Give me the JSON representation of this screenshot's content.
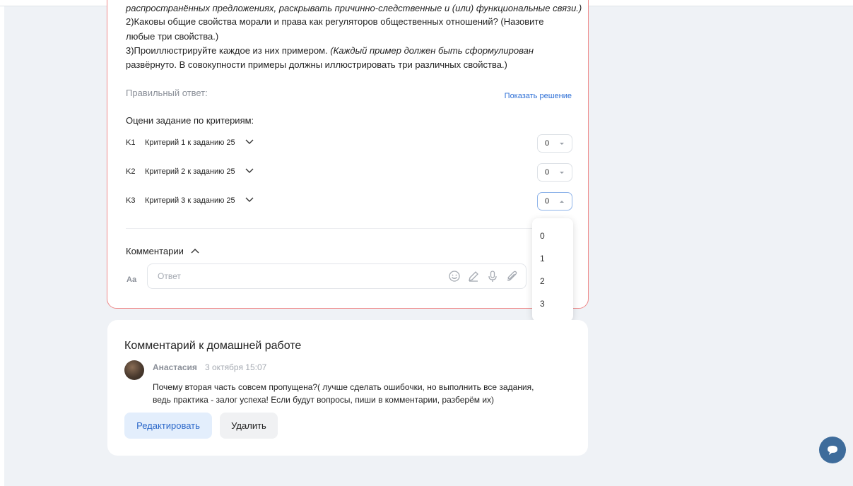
{
  "task": {
    "cut_line": "распространённых предложениях, раскрывать причинно-следственные и (или) функциональные связи.)",
    "q2_line1": "2)Каковы общие свойства морали и права как регуляторов общественных отношений? (Назовите",
    "q2_line2": "любые три свойства.)",
    "q3_prefix": "3)Проиллюстрируйте каждое из них примером. ",
    "q3_italic1": "(Каждый пример должен быть сформулирован",
    "q3_italic2": "развёрнуто. В совокупности примеры должны иллюстрировать три различных свойства.)",
    "answer_label": "Правильный ответ:",
    "show_solution": "Показать решение",
    "criteria_title": "Оцени задание по критериям:",
    "criteria": [
      {
        "code": "K1",
        "name": "Критерий 1 к заданию 25",
        "value": "0"
      },
      {
        "code": "K2",
        "name": "Критерий 2 к заданию 25",
        "value": "0"
      },
      {
        "code": "K3",
        "name": "Критерий 3 к заданию 25",
        "value": "0"
      }
    ],
    "comments_label": "Комментарии",
    "aa_label": "Aa",
    "reply_placeholder": "Ответ"
  },
  "dropdown": {
    "options": [
      "0",
      "1",
      "2",
      "3"
    ]
  },
  "homework_comment": {
    "title": "Комментарий к домашней работе",
    "author": "Анастасия",
    "date": "3 октября 15:07",
    "text_line1": "Почему вторая часть совсем пропущена?( лучше сделать ошибочки, но выполнить все задания,",
    "text_line2": "ведь практика - залог успеха! Если будут вопросы, пиши в комментарии, разберём их)",
    "edit_label": "Редактировать",
    "delete_label": "Удалить"
  },
  "colors": {
    "accent": "#2d6fd6",
    "task_border": "#ef8a8a",
    "page_bg": "#eff2f6",
    "chat_button": "#3e6c9b"
  },
  "icons": [
    "chevron-down-icon",
    "chevron-up-icon",
    "emoji-icon",
    "pencil-icon",
    "microphone-icon",
    "paperclip-icon",
    "chat-icon"
  ]
}
